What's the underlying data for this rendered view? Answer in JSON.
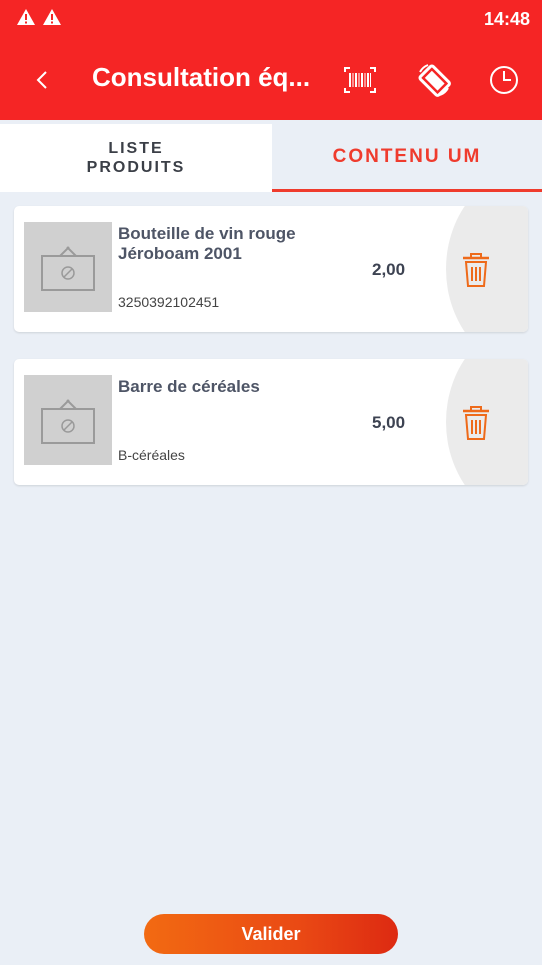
{
  "status_bar": {
    "time": "14:48",
    "icons": [
      "warning-icon",
      "warning-icon"
    ]
  },
  "app_bar": {
    "title": "Consultation éq...",
    "back_icon": "back-chevron-icon",
    "actions": [
      "barcode-scan-icon",
      "screen-rotate-icon",
      "clock-history-icon"
    ]
  },
  "tabs": [
    {
      "label": "LISTE\nPRODUITS",
      "selected": false
    },
    {
      "label": "CONTENU UM",
      "selected": true
    }
  ],
  "items": [
    {
      "name": "Bouteille de vin rouge Jéroboam 2001",
      "code": "3250392102451",
      "quantity": "2,00"
    },
    {
      "name": "Barre de céréales",
      "code": "B-céréales",
      "quantity": "5,00"
    }
  ],
  "footer": {
    "validate_label": "Valider"
  },
  "colors": {
    "primary": "#f52525",
    "accent": "#ef3b2d",
    "button": "#ea4a14"
  }
}
